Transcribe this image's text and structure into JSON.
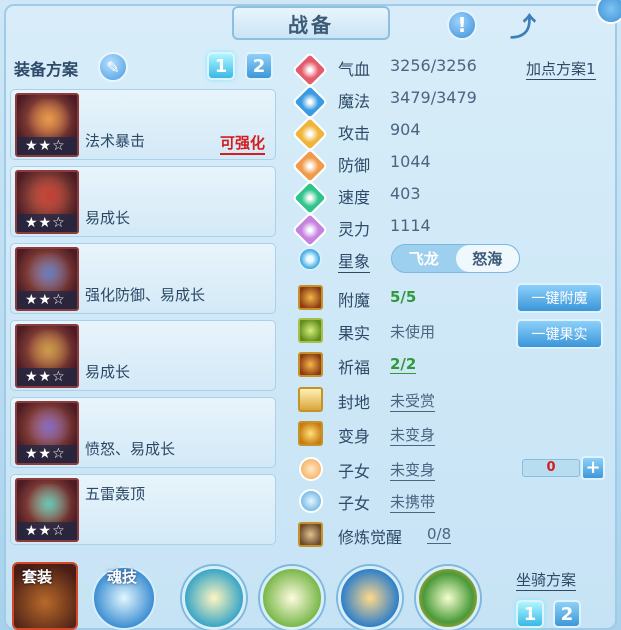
{
  "header": {
    "title": "战备",
    "help_glyph": "!",
    "share_glyph": "⤴"
  },
  "left": {
    "plan_label": "装备方案",
    "plan_buttons": [
      "1",
      "2"
    ],
    "equipment": [
      {
        "name": "法术暴击",
        "tag": "可强化",
        "stars": "★★☆",
        "icon": "paddle-weapon-icon",
        "color": "#e9a04b"
      },
      {
        "name": "易成长",
        "tag": "",
        "stars": "★★☆",
        "icon": "helmet-icon",
        "color": "#c23a33"
      },
      {
        "name": "强化防御、易成长",
        "tag": "",
        "stars": "★★☆",
        "icon": "armor-icon",
        "color": "#5a7fd1"
      },
      {
        "name": "易成长",
        "tag": "",
        "stars": "★★☆",
        "icon": "necklace-icon",
        "color": "#c8a24a"
      },
      {
        "name": "愤怒、易成长",
        "tag": "",
        "stars": "★★☆",
        "icon": "belt-icon",
        "color": "#7a6ad1"
      },
      {
        "name": "五雷轰顶",
        "tag": "",
        "stars": "★★☆",
        "icon": "boots-icon",
        "color": "#5ad1c5"
      }
    ]
  },
  "stats": {
    "points_plan": "加点方案1",
    "items": [
      {
        "label": "气血",
        "value": "3256/3256",
        "icon": "heart-icon",
        "color": "#e45c6b"
      },
      {
        "label": "魔法",
        "value": "3479/3479",
        "icon": "mana-icon",
        "color": "#3a9be3"
      },
      {
        "label": "攻击",
        "value": "904",
        "icon": "sword-icon",
        "color": "#f0b43a"
      },
      {
        "label": "防御",
        "value": "1044",
        "icon": "shield-icon",
        "color": "#f09a4a"
      },
      {
        "label": "速度",
        "value": "403",
        "icon": "lightning-icon",
        "color": "#2fc48a"
      },
      {
        "label": "灵力",
        "value": "1114",
        "icon": "spirit-icon",
        "color": "#c582df"
      }
    ]
  },
  "constellation": {
    "label": "星象",
    "options": [
      "飞龙",
      "怒海"
    ],
    "selected": "怒海"
  },
  "enhancements": {
    "enchant": {
      "label": "附魔",
      "value": "5/5",
      "button": "一键附魔"
    },
    "fruit": {
      "label": "果实",
      "value": "未使用",
      "button": "一键果实"
    },
    "blessing": {
      "label": "祈福",
      "value": "2/2"
    },
    "fief": {
      "label": "封地",
      "value": "未受赏"
    },
    "transform": {
      "label": "变身",
      "value": "未变身"
    },
    "child1": {
      "label": "子女",
      "value": "未变身",
      "counter": "0",
      "plus": "+"
    },
    "child2": {
      "label": "子女",
      "value": "未携带"
    },
    "cultivation": {
      "label": "修炼觉醒",
      "value": "0/8"
    }
  },
  "bottom": {
    "suit_label": "套装",
    "soul_label": "魂技",
    "orbs": [
      "figure-skill-icon",
      "wind-skill-icon",
      "wave-skill-icon",
      "leaf-skill-icon"
    ],
    "mount_label": "坐骑方案",
    "mount_buttons": [
      "1",
      "2"
    ]
  }
}
